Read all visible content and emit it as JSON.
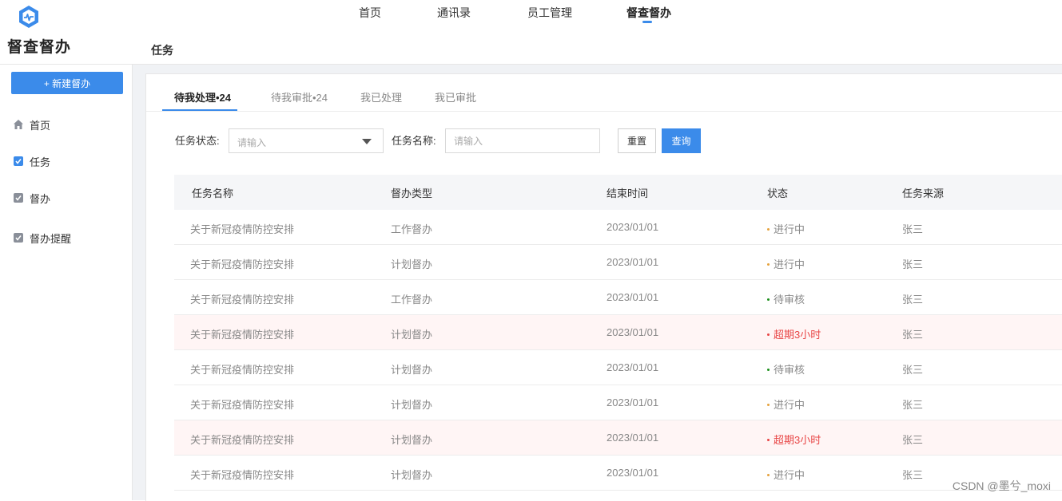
{
  "header": {
    "app_title": "督查督办",
    "nav": [
      "首页",
      "通讯录",
      "员工管理",
      "督查督办"
    ],
    "active_nav": "督查督办",
    "page_title": "任务"
  },
  "sidebar": {
    "new_button": "+ 新建督办",
    "items": [
      {
        "label": "首页",
        "icon": "home-icon"
      },
      {
        "label": "任务",
        "icon": "task-check-icon"
      },
      {
        "label": "督办",
        "icon": "supervise-icon"
      },
      {
        "label": "督办提醒",
        "icon": "reminder-icon"
      }
    ]
  },
  "tabs": [
    "待我处理•24",
    "待我审批•24",
    "我已处理",
    "我已审批"
  ],
  "active_tab": "待我处理•24",
  "filters": {
    "status_label": "任务状态:",
    "status_placeholder": "请输入",
    "name_label": "任务名称:",
    "name_placeholder": "请输入",
    "reset": "重置",
    "query": "查询"
  },
  "table": {
    "columns": [
      "任务名称",
      "督办类型",
      "结束时间",
      "状态",
      "任务来源"
    ],
    "rows": [
      {
        "name": "关于新冠疫情防控安排",
        "type": "工作督办",
        "end": "2023/01/01",
        "status": "进行中",
        "source": "张三"
      },
      {
        "name": "关于新冠疫情防控安排",
        "type": "计划督办",
        "end": "2023/01/01",
        "status": "进行中",
        "source": "张三"
      },
      {
        "name": "关于新冠疫情防控安排",
        "type": "工作督办",
        "end": "2023/01/01",
        "status": "待审核",
        "source": "张三"
      },
      {
        "name": "关于新冠疫情防控安排",
        "type": "计划督办",
        "end": "2023/01/01",
        "status": "超期3小时",
        "source": "张三"
      },
      {
        "name": "关于新冠疫情防控安排",
        "type": "计划督办",
        "end": "2023/01/01",
        "status": "待审核",
        "source": "张三"
      },
      {
        "name": "关于新冠疫情防控安排",
        "type": "计划督办",
        "end": "2023/01/01",
        "status": "进行中",
        "source": "张三"
      },
      {
        "name": "关于新冠疫情防控安排",
        "type": "计划督办",
        "end": "2023/01/01",
        "status": "超期3小时",
        "source": "张三"
      },
      {
        "name": "关于新冠疫情防控安排",
        "type": "计划督办",
        "end": "2023/01/01",
        "status": "进行中",
        "source": "张三"
      }
    ]
  },
  "status_colors": {
    "进行中": "#e6a23c",
    "待审核": "#1a8f1a",
    "超期3小时": "#e84545"
  },
  "colors": {
    "accent": "#3b8bea",
    "overdue_row": "#fff5f5"
  },
  "watermark": "CSDN @墨兮_moxi"
}
